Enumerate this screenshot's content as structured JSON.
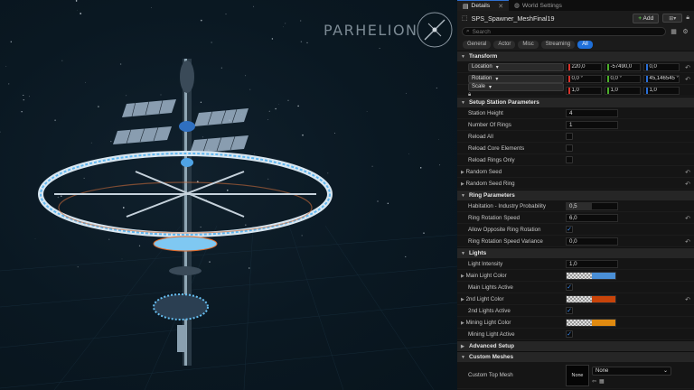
{
  "viewport": {
    "logo_text": "PARHELION"
  },
  "tabs": [
    {
      "label": "Details",
      "active": true
    },
    {
      "label": "World Settings",
      "active": false
    }
  ],
  "actor": {
    "name": "SPS_Spawner_MeshFinal19",
    "add_label": "Add"
  },
  "search": {
    "placeholder": "Search"
  },
  "filters": [
    "General",
    "Actor",
    "Misc",
    "Streaming",
    "All"
  ],
  "sections": {
    "transform": "Transform",
    "setup": "Setup Station Parameters",
    "ring": "Ring Parameters",
    "lights": "Lights",
    "advanced": "Advanced Setup",
    "meshes": "Custom Meshes"
  },
  "transform": {
    "location": {
      "label": "Location",
      "x": "220,0",
      "y": "-57490,0",
      "z": "0,0"
    },
    "rotation": {
      "label": "Rotation",
      "x": "0,0 °",
      "y": "0,0 °",
      "z": "45,146545 °"
    },
    "scale": {
      "label": "Scale",
      "x": "1,0",
      "y": "1,0",
      "z": "1,0"
    }
  },
  "setup": {
    "station_height": {
      "label": "Station Height",
      "value": "4"
    },
    "number_of_rings": {
      "label": "Number Of Rings",
      "value": "1"
    },
    "reload_all": "Reload All",
    "reload_core": "Reload Core Elements",
    "reload_rings": "Reload Rings Only",
    "random_seed": "Random Seed",
    "random_seed_ring": "Random Seed Ring"
  },
  "ring": {
    "habitation": {
      "label": "Habitation - Industry Probability",
      "value": "0,5"
    },
    "rotation_speed": {
      "label": "Ring Rotation Speed",
      "value": "6,0"
    },
    "allow_opposite": "Allow Opposite Ring Rotation",
    "speed_variance": {
      "label": "Ring Rotation Speed Variance",
      "value": "0,0"
    }
  },
  "lights": {
    "intensity": {
      "label": "Light Intensity",
      "value": "1,0"
    },
    "main_color": "Main Light Color",
    "main_active": "Main Lights Active",
    "second_color": "2nd Light Color",
    "second_active": "2nd Lights Active",
    "mining_color": "Mining Light Color",
    "mining_active": "Mining Light Active"
  },
  "colors": {
    "main": "#4a8fd6",
    "second": "#c8440a",
    "mining": "#e08a10",
    "accent": "#1e6fd9"
  },
  "meshes": {
    "top_label": "Custom Top Mesh",
    "thumb": "None",
    "selected": "None"
  }
}
